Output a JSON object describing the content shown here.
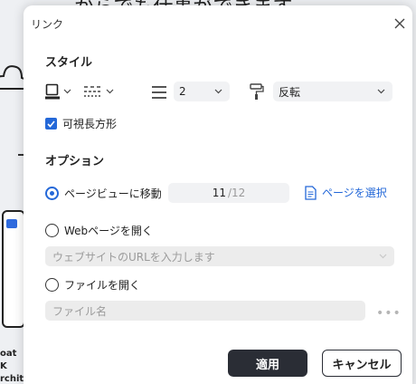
{
  "background": {
    "heading_text": "…からでも仕事ができます。",
    "caption_lines": [
      "oat K",
      "rchitec"
    ]
  },
  "dialog": {
    "title": "リンク",
    "close_icon": "close-icon",
    "style_section": {
      "heading": "スタイル",
      "border_color_icon": "border-color-icon",
      "line_style_icon": "dashed-line-icon",
      "line_width_icon": "line-width-icon",
      "line_width_value": "2",
      "highlight_icon": "paint-roller-icon",
      "highlight_value": "反転",
      "visible_rect_checkbox": {
        "label": "可視長方形",
        "checked": true
      }
    },
    "options_section": {
      "heading": "オプション",
      "go_to_page": {
        "label": "ページビューに移動",
        "selected": true,
        "current_page": "11",
        "total_pages": "/12",
        "select_page_label": "ページを選択"
      },
      "open_web_page": {
        "label": "Webページを開く",
        "selected": false,
        "url_placeholder": "ウェブサイトのURLを入力します"
      },
      "open_file": {
        "label": "ファイルを開く",
        "selected": false,
        "file_placeholder": "ファイル名",
        "more_label": "•••"
      }
    },
    "buttons": {
      "apply": "適用",
      "cancel": "キャンセル"
    }
  },
  "colors": {
    "accent": "#2468d8",
    "primary_button": "#2a2d35"
  }
}
